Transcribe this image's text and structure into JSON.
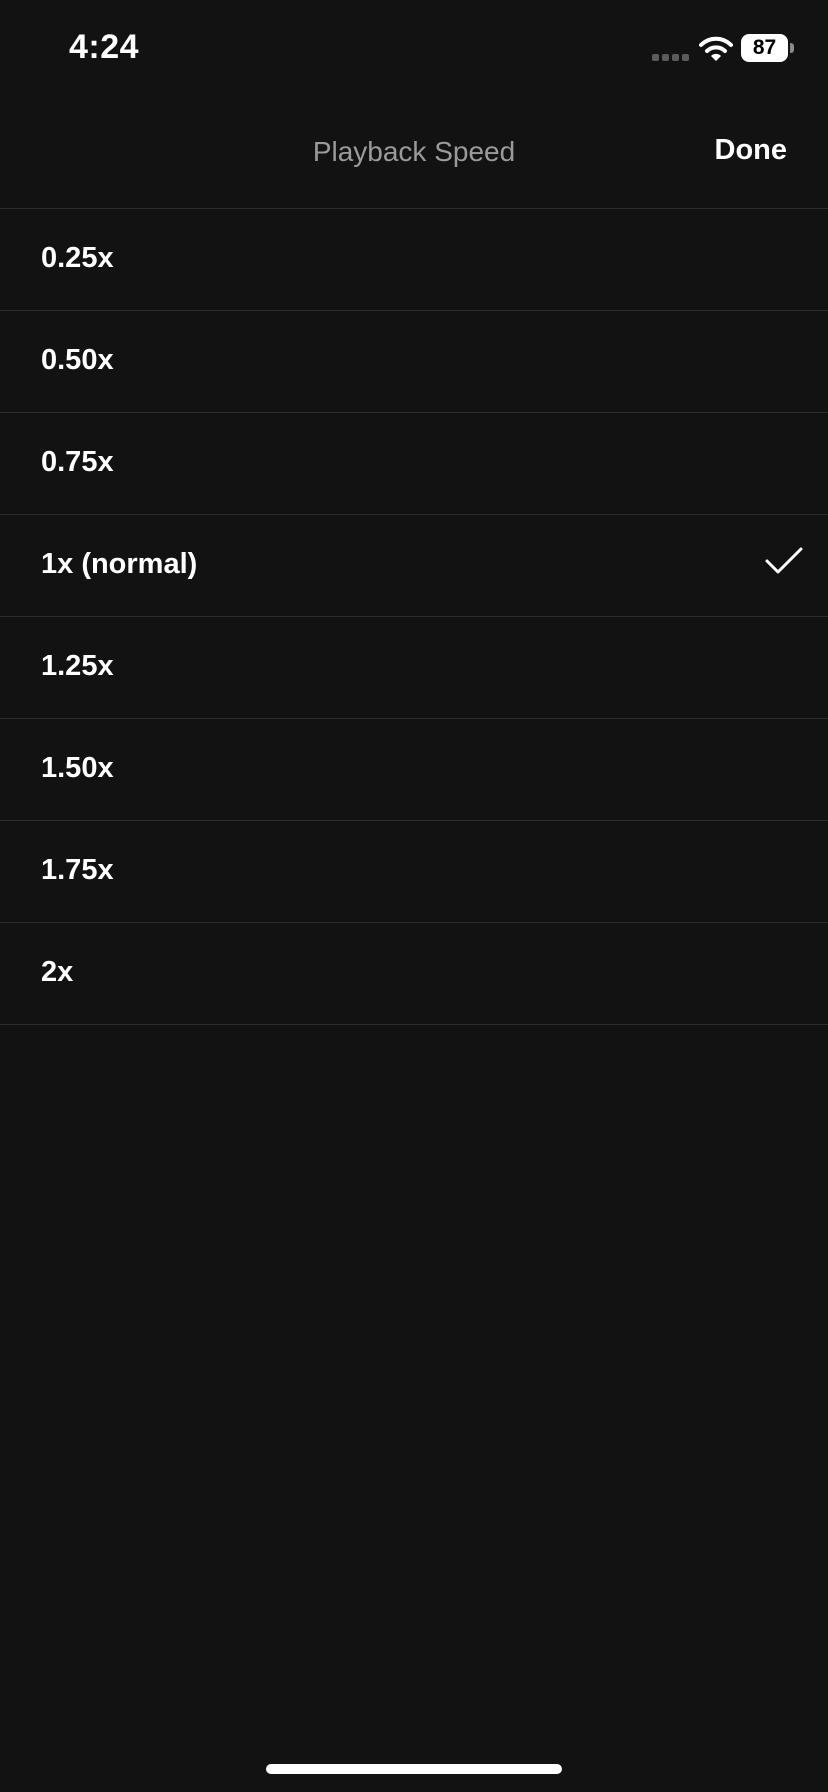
{
  "status_bar": {
    "time": "4:24",
    "battery": "87",
    "icons": [
      "signal-icon",
      "wifi-icon",
      "battery-icon"
    ]
  },
  "header": {
    "title": "Playback Speed",
    "done_label": "Done"
  },
  "speeds": [
    {
      "label": "0.25x",
      "selected": false
    },
    {
      "label": "0.50x",
      "selected": false
    },
    {
      "label": "0.75x",
      "selected": false
    },
    {
      "label": "1x (normal)",
      "selected": true
    },
    {
      "label": "1.25x",
      "selected": false
    },
    {
      "label": "1.50x",
      "selected": false
    },
    {
      "label": "1.75x",
      "selected": false
    },
    {
      "label": "2x",
      "selected": false
    }
  ],
  "colors": {
    "background": "#121212",
    "divider": "#2c2c2c",
    "title": "#9a9a9a",
    "text": "#ffffff"
  }
}
